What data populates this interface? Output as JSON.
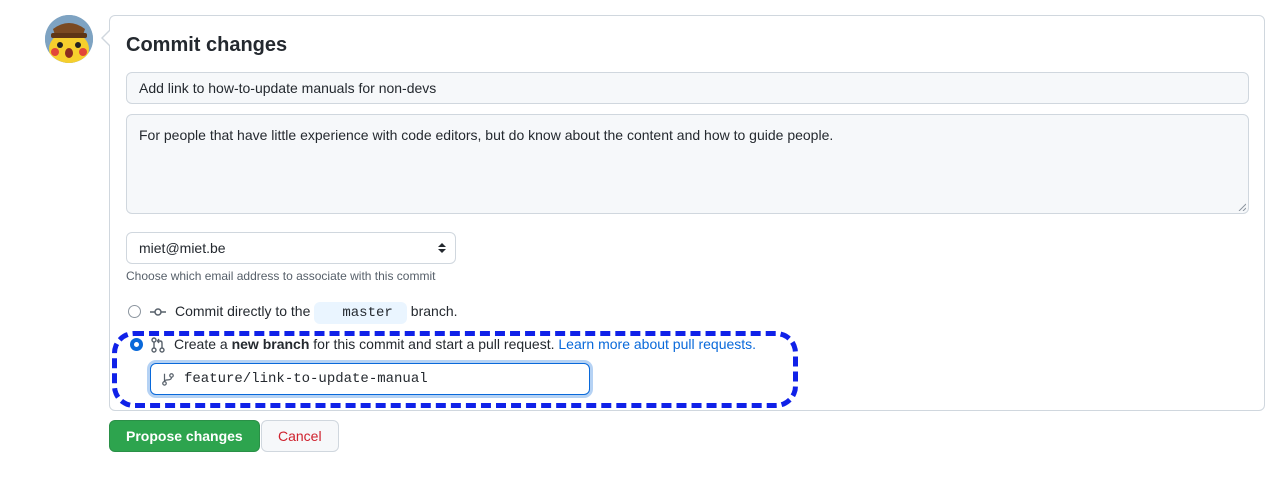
{
  "commit_form": {
    "title": "Commit changes",
    "summary_value": "Add link to how-to-update manuals for non-devs",
    "description_value": "For people that have little experience with code editors, but do know about the content and how to guide people.",
    "email_selected": "miet@miet.be",
    "email_note": "Choose which email address to associate with this commit",
    "option_direct": {
      "prefix": "Commit directly to the",
      "branch": "master",
      "suffix": "branch.",
      "selected": false
    },
    "option_new_branch": {
      "prefix": "Create a",
      "bold": "new branch",
      "middle": "for this commit and start a pull request.",
      "link": "Learn more about pull requests.",
      "selected": true
    },
    "new_branch_name": "feature/link-to-update-manual"
  },
  "buttons": {
    "propose": "Propose changes",
    "cancel": "Cancel"
  },
  "icons": {
    "avatar": "pikachu-avatar",
    "commit": "git-commit-icon",
    "pull_request": "git-pull-request-icon",
    "branch": "git-branch-icon"
  },
  "colors": {
    "primary_button": "#2da44e",
    "cancel_text": "#cf222e",
    "link": "#0969da",
    "highlight_dashes": "#1021e8"
  }
}
